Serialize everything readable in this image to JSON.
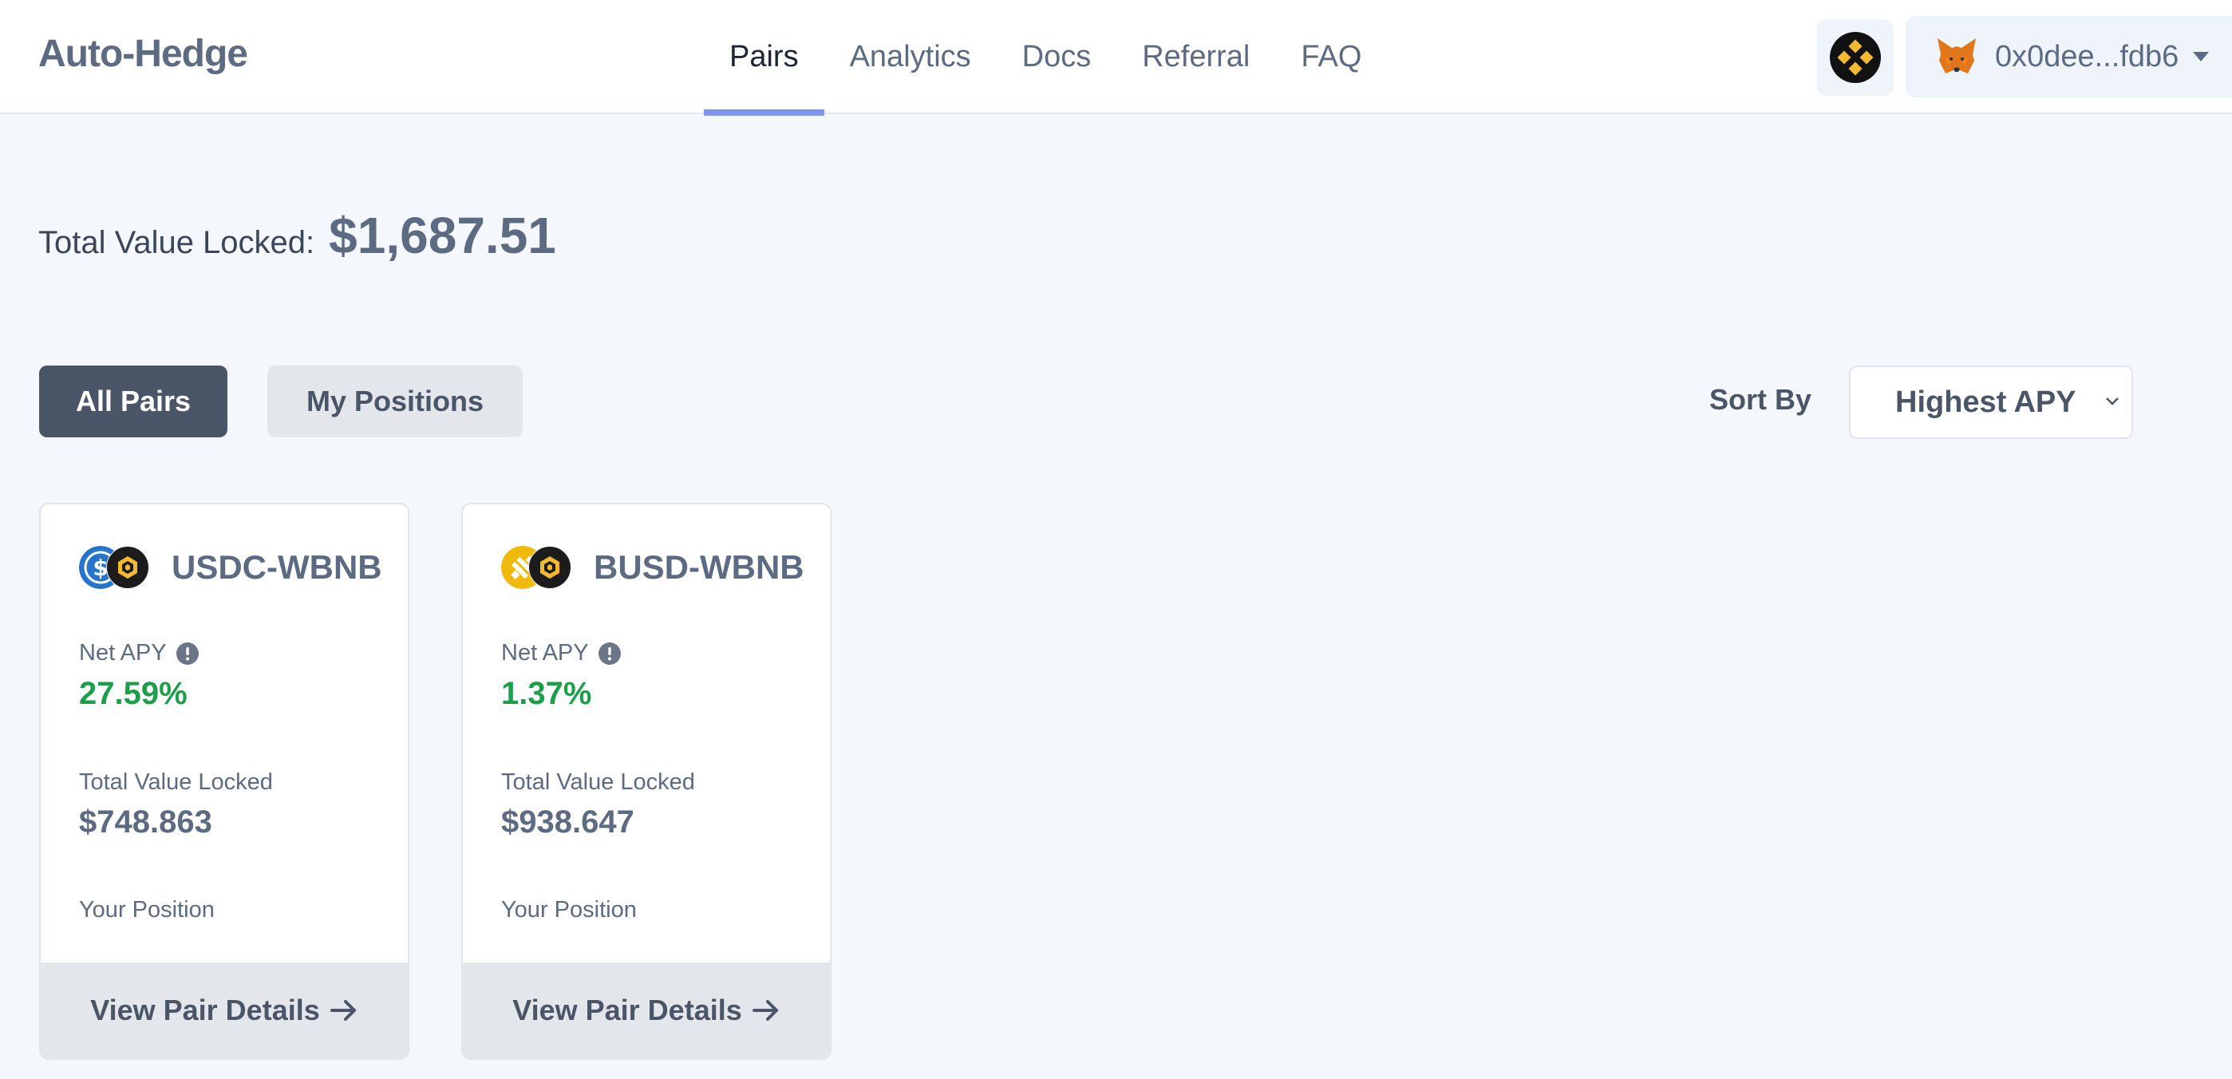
{
  "header": {
    "logo": "Auto-Hedge",
    "nav": [
      {
        "label": "Pairs",
        "active": true
      },
      {
        "label": "Analytics",
        "active": false
      },
      {
        "label": "Docs",
        "active": false
      },
      {
        "label": "Referral",
        "active": false
      },
      {
        "label": "FAQ",
        "active": false
      }
    ],
    "chain_icon": "bnb-chain-icon",
    "wallet": {
      "icon": "metamask-fox-icon",
      "address": "0x0dee...fdb6"
    }
  },
  "summary": {
    "tvl_label": "Total Value Locked:",
    "tvl_value": "$1,687.51"
  },
  "tabs": {
    "all": "All Pairs",
    "mine": "My Positions"
  },
  "sort": {
    "label": "Sort By",
    "selected": "Highest APY"
  },
  "pairs": [
    {
      "name": "USDC-WBNB",
      "icons": [
        "usdc-icon",
        "wbnb-icon"
      ],
      "apy_label": "Net APY",
      "apy": "27.59%",
      "tvl_label": "Total Value Locked",
      "tvl": "$748.863",
      "position_label": "Your Position",
      "details_label": "View Pair Details"
    },
    {
      "name": "BUSD-WBNB",
      "icons": [
        "busd-icon",
        "wbnb-icon"
      ],
      "apy_label": "Net APY",
      "apy": "1.37%",
      "tvl_label": "Total Value Locked",
      "tvl": "$938.647",
      "position_label": "Your Position",
      "details_label": "View Pair Details"
    }
  ],
  "colors": {
    "accent": "#7f96ea",
    "positive": "#1e9d4a",
    "primary_button": "#4a5567",
    "bnb_yellow": "#f3ba2f",
    "usdc_blue": "#2775ca"
  }
}
